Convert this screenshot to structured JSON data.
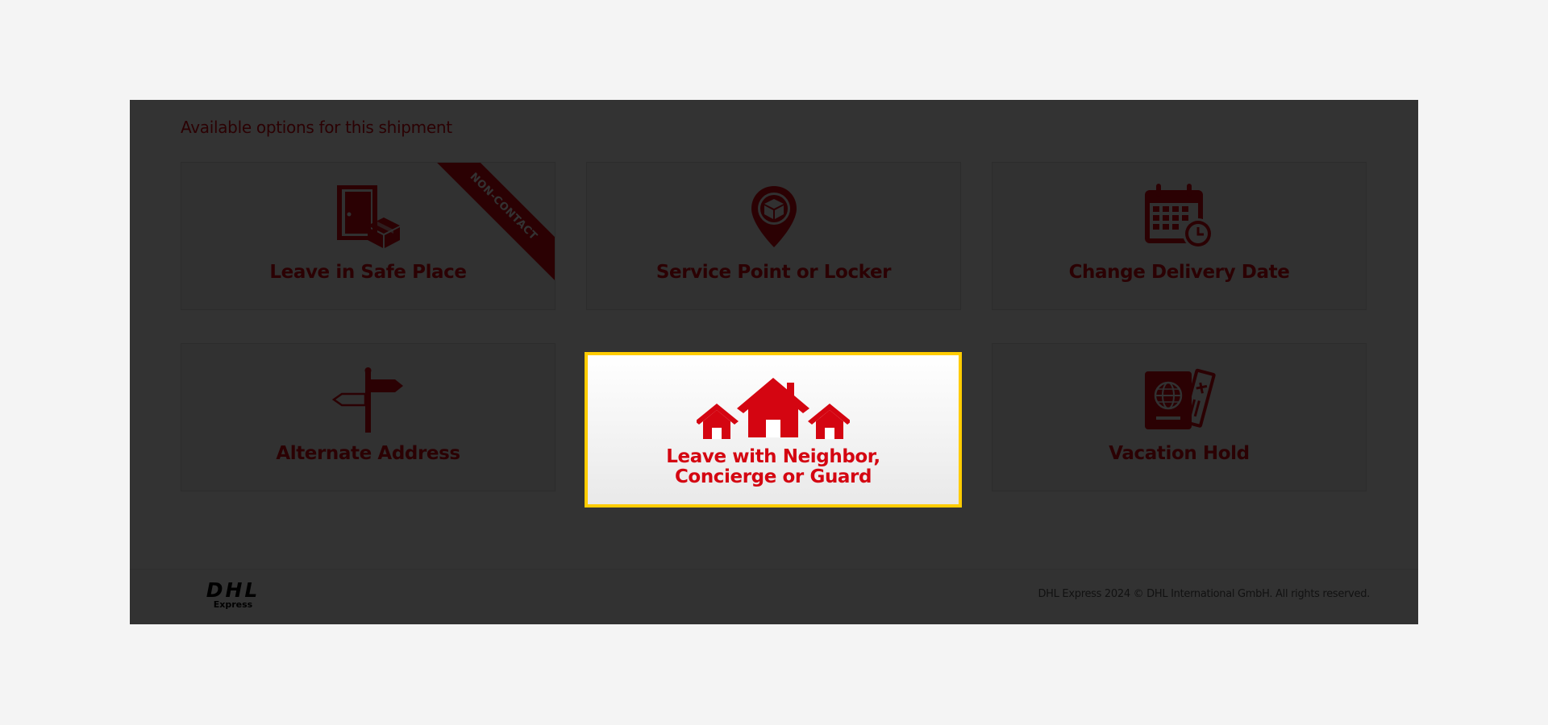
{
  "heading": "Available options for this shipment",
  "options": [
    {
      "label": "Leave in Safe Place",
      "icon": "door-package-icon",
      "badge": "NON-CONTACT"
    },
    {
      "label": "Service Point or Locker",
      "icon": "location-pin-package-icon"
    },
    {
      "label": "Change Delivery Date",
      "icon": "calendar-clock-icon"
    },
    {
      "label": "Alternate Address",
      "icon": "signpost-icon"
    },
    {
      "label_line1": "Leave with Neighbor,",
      "label_line2": "Concierge or Guard",
      "icon": "houses-icon",
      "highlighted": true
    },
    {
      "label": "Vacation Hold",
      "icon": "passport-ticket-icon"
    }
  ],
  "footer": {
    "logo_text": "DHL",
    "logo_subtext": "Express",
    "copyright": "DHL Express 2024 © DHL International GmbH. All rights reserved."
  },
  "colors": {
    "brand_red": "#d40511",
    "brand_yellow": "#ffcc00",
    "overlay": "rgba(0,0,0,0.80)"
  }
}
